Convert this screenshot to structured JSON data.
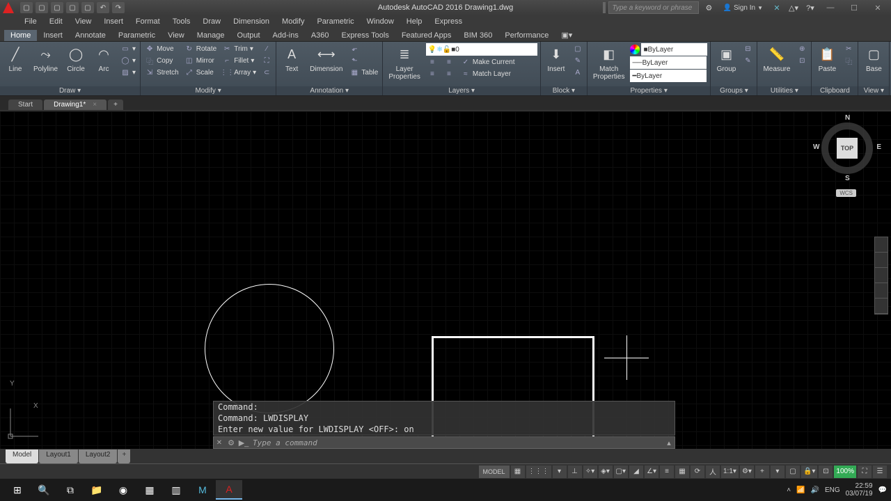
{
  "title": "Autodesk AutoCAD 2016   Drawing1.dwg",
  "search_placeholder": "Type a keyword or phrase",
  "signin": "Sign In",
  "menu": [
    "File",
    "Edit",
    "View",
    "Insert",
    "Format",
    "Tools",
    "Draw",
    "Dimension",
    "Modify",
    "Parametric",
    "Window",
    "Help",
    "Express"
  ],
  "ribbon_tabs": [
    "Home",
    "Insert",
    "Annotate",
    "Parametric",
    "View",
    "Manage",
    "Output",
    "Add-ins",
    "A360",
    "Express Tools",
    "Featured Apps",
    "BIM 360",
    "Performance"
  ],
  "active_ribbon_tab": "Home",
  "panels": {
    "draw": {
      "title": "Draw ▾",
      "line": "Line",
      "polyline": "Polyline",
      "circle": "Circle",
      "arc": "Arc"
    },
    "modify": {
      "title": "Modify ▾",
      "move": "Move",
      "rotate": "Rotate",
      "trim": "Trim",
      "copy": "Copy",
      "mirror": "Mirror",
      "fillet": "Fillet",
      "stretch": "Stretch",
      "scale": "Scale",
      "array": "Array"
    },
    "annotation": {
      "title": "Annotation ▾",
      "text": "Text",
      "dimension": "Dimension",
      "table": "Table"
    },
    "layers": {
      "title": "Layers ▾",
      "props": "Layer\nProperties",
      "current": "0",
      "makecur": "Make Current",
      "match": "Match Layer"
    },
    "block": {
      "title": "Block ▾",
      "insert": "Insert"
    },
    "properties": {
      "title": "Properties ▾",
      "match": "Match\nProperties",
      "color": "ByLayer",
      "ltype": "ByLayer",
      "lweight": "ByLayer"
    },
    "groups": {
      "title": "Groups ▾",
      "group": "Group"
    },
    "utilities": {
      "title": "Utilities ▾",
      "measure": "Measure"
    },
    "clipboard": {
      "title": "Clipboard",
      "paste": "Paste"
    },
    "view": {
      "title": "View ▾",
      "base": "Base"
    }
  },
  "filetabs": {
    "start": "Start",
    "drawing": "Drawing1*"
  },
  "viewcube": {
    "top": "TOP",
    "n": "N",
    "s": "S",
    "e": "E",
    "w": "W",
    "wcs": "WCS"
  },
  "ucs": {
    "x": "X",
    "y": "Y"
  },
  "cmd": {
    "l1": "Command:",
    "l2": "Command: LWDISPLAY",
    "l3": "Enter new value for LWDISPLAY <OFF>: on",
    "placeholder": "Type a command"
  },
  "modeltabs": {
    "model": "Model",
    "l1": "Layout1",
    "l2": "Layout2"
  },
  "status": {
    "model": "MODEL",
    "scale": "1:1",
    "zoom": "100%"
  },
  "tray": {
    "time": "22:59",
    "date": "03/07/19"
  }
}
